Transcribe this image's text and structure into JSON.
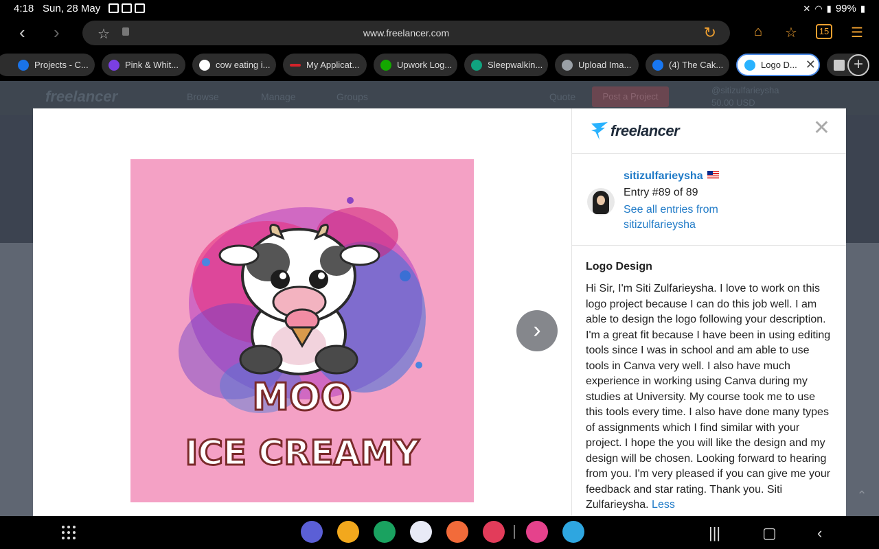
{
  "status": {
    "time": "4:18",
    "date": "Sun, 28 May",
    "battery": "99%"
  },
  "browser": {
    "url": "www.freelancer.com",
    "tab_count": "15",
    "tabs": [
      {
        "label": "Projects - C...",
        "color": "#1a73e8"
      },
      {
        "label": "Pink & Whit...",
        "color": "#7b3fe4"
      },
      {
        "label": "cow eating i...",
        "color": "#ffffff"
      },
      {
        "label": "My Applicat...",
        "color": "#d2232a"
      },
      {
        "label": "Upwork Log...",
        "color": "#14a800"
      },
      {
        "label": "Sleepwalkin...",
        "color": "#10a37f"
      },
      {
        "label": "Upload Ima...",
        "color": "#9aa0a6"
      },
      {
        "label": "(4) The Cak...",
        "color": "#1877f2"
      },
      {
        "label": "Logo D...",
        "color": "#29b2fe"
      }
    ]
  },
  "site_header": {
    "nav": [
      "Browse",
      "Manage",
      "Groups"
    ],
    "quote": "Quote",
    "post_project": "Post a Project",
    "user": "@sitizulfarieysha",
    "balance": "50.00 USD"
  },
  "modal": {
    "brand": "freelancer",
    "user_name": "sitizulfarieysha",
    "entry": "Entry #89 of 89",
    "see_all": "See all entries from sitizulfarieysha",
    "desc_title": "Logo Design",
    "description": "Hi Sir, I'm Siti Zulfarieysha. I love to work on this logo project because I can do this job well. I am able to design the logo following your description. I'm a great fit because I have been in using editing tools since I was in school and am able to use tools in Canva very well. I also have much experience in working using Canva during my studies at University. My course took me to use this tools every time. I also have done many types of assignments which I find similar with your project. I hope the you will like the design and my design will be chosen. Looking forward to hearing from you. I'm very pleased if you can give me your feedback and star rating. Thank you. Siti Zulfarieysha.",
    "less": "Less",
    "artwork": {
      "line1": "MOO",
      "line2": "ICE CREAMY"
    }
  },
  "dock_apps": [
    {
      "name": "internet",
      "color": "#5b5fd6"
    },
    {
      "name": "files",
      "color": "#f2a81d"
    },
    {
      "name": "phone",
      "color": "#1aa260"
    },
    {
      "name": "messages",
      "color": "#e8eaf6"
    },
    {
      "name": "contacts",
      "color": "#f26b3a"
    },
    {
      "name": "camera",
      "color": "#e23c5a"
    },
    {
      "name": "flower",
      "color": "#e5428c"
    },
    {
      "name": "telegram",
      "color": "#2ea6e0"
    }
  ]
}
